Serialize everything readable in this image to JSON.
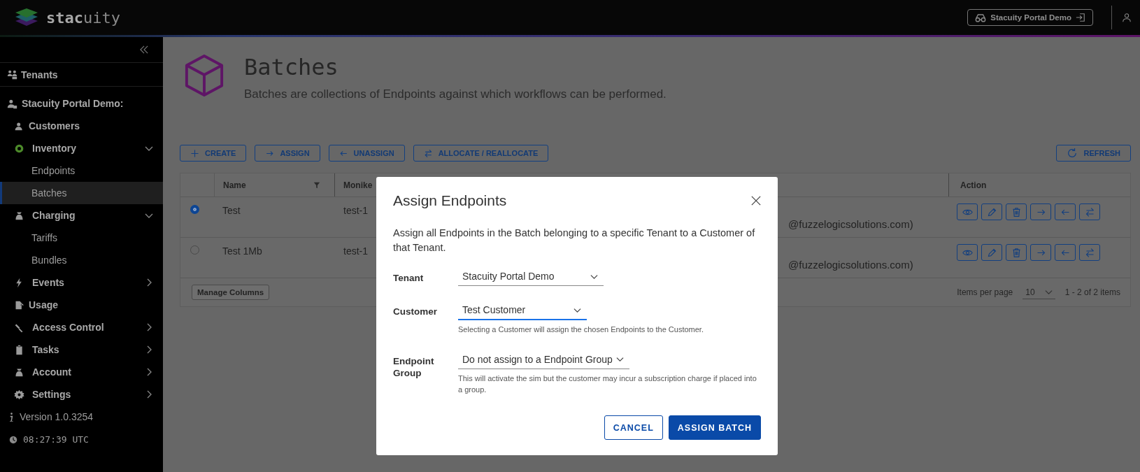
{
  "header": {
    "logo": "**stac**uity",
    "tenant_button": "Stacuity Portal Demo"
  },
  "sidebar": {
    "tenants": "Tenants",
    "section": "Stacuity Portal Demo:",
    "items": [
      {
        "label": "Customers",
        "kind": "link"
      },
      {
        "label": "Inventory",
        "kind": "group",
        "expanded": true,
        "children": [
          {
            "label": "Endpoints",
            "selected": false
          },
          {
            "label": "Batches",
            "selected": true
          }
        ]
      },
      {
        "label": "Charging",
        "kind": "group",
        "expanded": true,
        "children": [
          {
            "label": "Tariffs",
            "selected": false
          },
          {
            "label": "Bundles",
            "selected": false
          }
        ]
      },
      {
        "label": "Events",
        "kind": "group",
        "expanded": false
      },
      {
        "label": "Usage",
        "kind": "link"
      },
      {
        "label": "Access Control",
        "kind": "group",
        "expanded": false
      },
      {
        "label": "Tasks",
        "kind": "group",
        "expanded": false
      },
      {
        "label": "Account",
        "kind": "group",
        "expanded": false
      },
      {
        "label": "Settings",
        "kind": "group",
        "expanded": false
      }
    ],
    "version": "Version 1.0.3254",
    "clock": "08:27:39 UTC"
  },
  "page": {
    "title": "Batches",
    "description": "Batches are collections of Endpoints against which workflows can be performed."
  },
  "toolbar": {
    "buttons": [
      "CREATE",
      "ASSIGN",
      "UNASSIGN",
      "ALLOCATE / REALLOCATE"
    ],
    "refresh": "REFRESH"
  },
  "table": {
    "columns": {
      "name": "Name",
      "column_3": "Monike",
      "action": "Action"
    },
    "rows": [
      {
        "selected": true,
        "name": "Test",
        "column_3": "test-1",
        "column_4": "@fuzzelogicsolutions.com)"
      },
      {
        "selected": false,
        "name": "Test 1Mb",
        "column_3": "test-1",
        "column_4": "@fuzzelogicsolutions.com)"
      }
    ],
    "footer": {
      "manage_columns": "Manage Columns",
      "items_per_page_label": "Items per page",
      "page_size": "10",
      "range": "1 - 2 of 2 items"
    }
  },
  "modal": {
    "title": "Assign Endpoints",
    "description": "Assign all Endpoints in the Batch belonging to a specific Tenant to a Customer of that Tenant.",
    "fields": [
      {
        "label": "Tenant",
        "value": "Stacuity Portal Demo",
        "focused": false
      },
      {
        "label": "Customer",
        "value": "Test Customer",
        "focused": true,
        "help": "Selecting a Customer will assign the chosen Endpoints to the Customer."
      },
      {
        "label": "Endpoint Group",
        "value": "Do not assign to a Endpoint Group",
        "focused": false,
        "help": "This will activate the sim but the customer may incur a subscription charge if placed into a group."
      }
    ],
    "buttons": [
      {
        "label": "CANCEL",
        "kind": "secondary"
      },
      {
        "label": "ASSIGN BATCH",
        "kind": "primary"
      }
    ]
  }
}
